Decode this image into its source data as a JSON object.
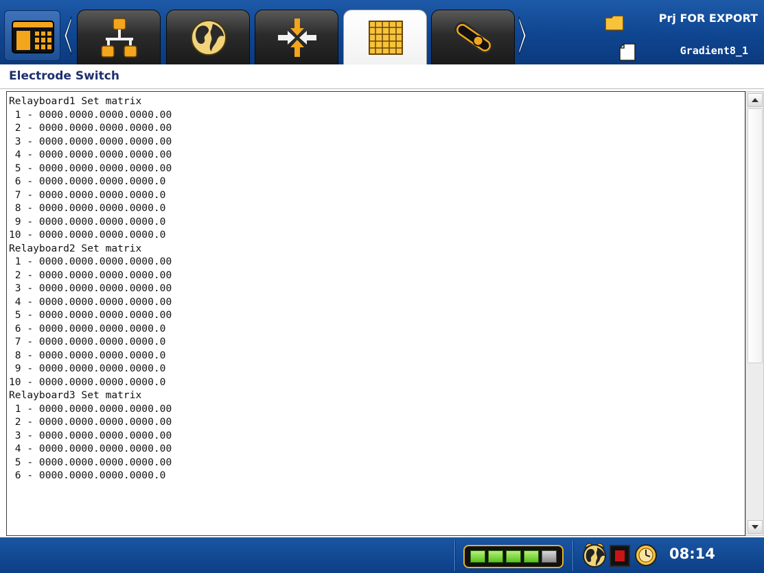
{
  "header": {
    "project_name": "Prj FOR EXPORT",
    "file_name": "Gradient8_1",
    "tabs": [
      {
        "icon": "network-icon",
        "active": false
      },
      {
        "icon": "globe-icon",
        "active": false
      },
      {
        "icon": "transfer-arrows-icon",
        "active": false
      },
      {
        "icon": "electrode-grid-icon",
        "active": true
      },
      {
        "icon": "cable-icon",
        "active": false
      }
    ]
  },
  "page": {
    "title": "Electrode Switch"
  },
  "content": {
    "lines": [
      "Relayboard1 Set matrix",
      " 1 - 0000.0000.0000.0000.00",
      " 2 - 0000.0000.0000.0000.00",
      " 3 - 0000.0000.0000.0000.00",
      " 4 - 0000.0000.0000.0000.00",
      " 5 - 0000.0000.0000.0000.00",
      " 6 - 0000.0000.0000.0000.0",
      " 7 - 0000.0000.0000.0000.0",
      " 8 - 0000.0000.0000.0000.0",
      " 9 - 0000.0000.0000.0000.0",
      "10 - 0000.0000.0000.0000.0",
      "Relayboard2 Set matrix",
      " 1 - 0000.0000.0000.0000.00",
      " 2 - 0000.0000.0000.0000.00",
      " 3 - 0000.0000.0000.0000.00",
      " 4 - 0000.0000.0000.0000.00",
      " 5 - 0000.0000.0000.0000.00",
      " 6 - 0000.0000.0000.0000.0",
      " 7 - 0000.0000.0000.0000.0",
      " 8 - 0000.0000.0000.0000.0",
      " 9 - 0000.0000.0000.0000.0",
      "10 - 0000.0000.0000.0000.0",
      "Relayboard3 Set matrix",
      " 1 - 0000.0000.0000.0000.00",
      " 2 - 0000.0000.0000.0000.00",
      " 3 - 0000.0000.0000.0000.00",
      " 4 - 0000.0000.0000.0000.00",
      " 5 - 0000.0000.0000.0000.00",
      " 6 - 0000.0000.0000.0000.0"
    ]
  },
  "status": {
    "battery_level": 0.8,
    "battery_cells_total": 5,
    "battery_cells_filled": 4,
    "time": "08:14"
  },
  "colors": {
    "bar_blue": "#0f4590",
    "accent_orange": "#f3a51c",
    "title_navy": "#1d2f6e",
    "battery_green": "#58c21c",
    "record_red": "#c91414"
  }
}
